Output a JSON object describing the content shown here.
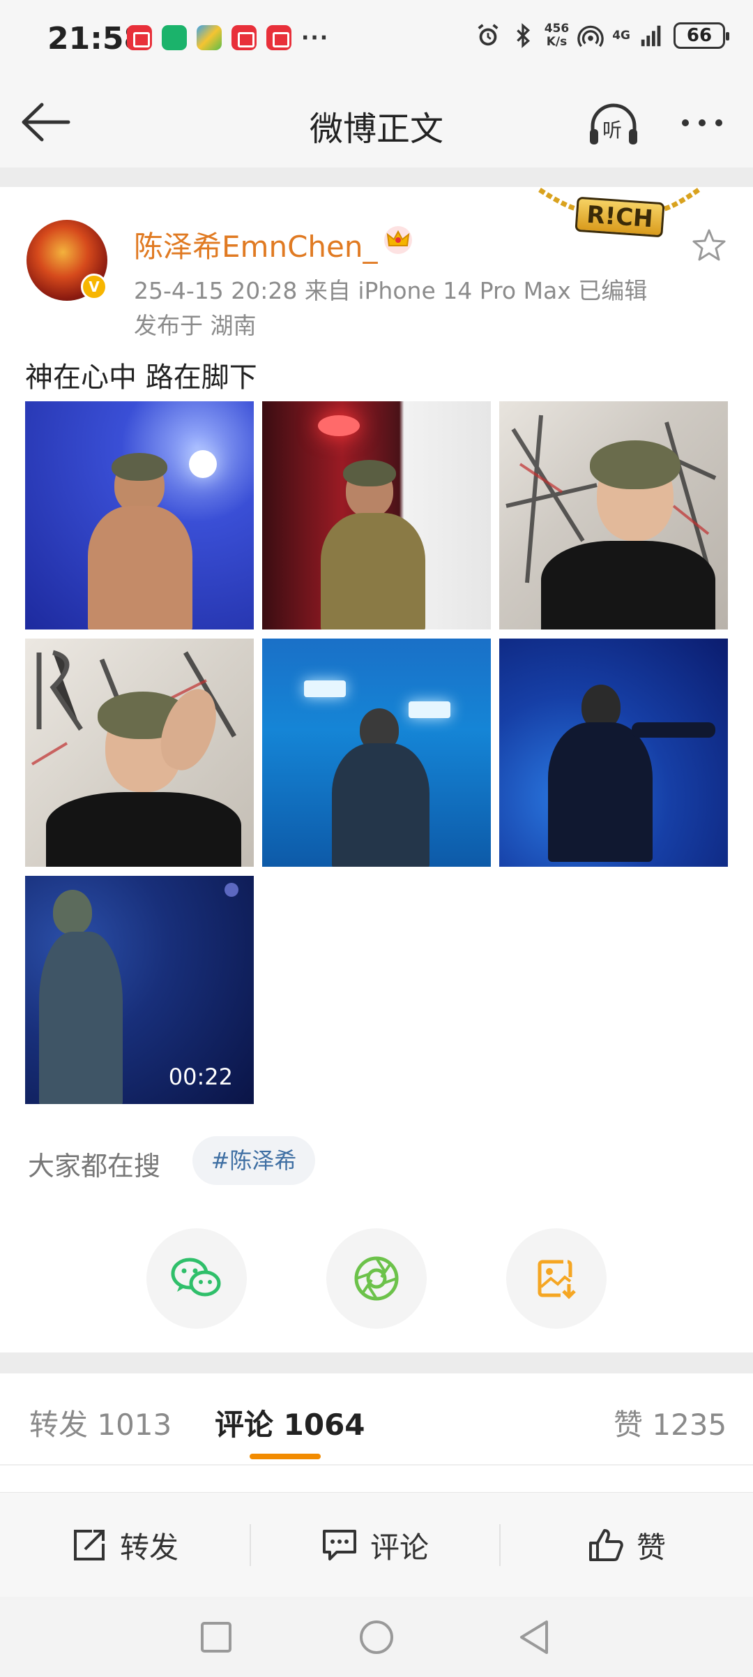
{
  "status_bar": {
    "time": "21:58",
    "more": "···",
    "speed_value": "456",
    "speed_unit": "K/s",
    "network": "4G",
    "battery": "66"
  },
  "nav": {
    "title": "微博正文",
    "listen_label": "听"
  },
  "post": {
    "username": "陈泽希EmnChen_",
    "verified_mark": "V",
    "meta": "25-4-15 20:28  来自 iPhone 14 Pro Max  已编辑",
    "location": "发布于 湖南",
    "text": "神在心中 路在脚下",
    "badge_text": "R!CH",
    "video_duration": "00:22"
  },
  "search": {
    "label": "大家都在搜",
    "tag": "#陈泽希"
  },
  "share": {
    "icons": [
      "wechat-icon",
      "moments-icon",
      "save-image-icon"
    ]
  },
  "tabs": {
    "repost": "转发 1013",
    "comment": "评论 1064",
    "like": "赞 1235"
  },
  "actions": {
    "repost": "转发",
    "comment": "评论",
    "like": "赞"
  },
  "colors": {
    "username": "#e07a22",
    "accent": "#f28b00",
    "tag_text": "#3f6fa3",
    "wechat_green": "#2fbf6a",
    "moments_green": "#6cc24a",
    "save_orange": "#f5a623"
  }
}
